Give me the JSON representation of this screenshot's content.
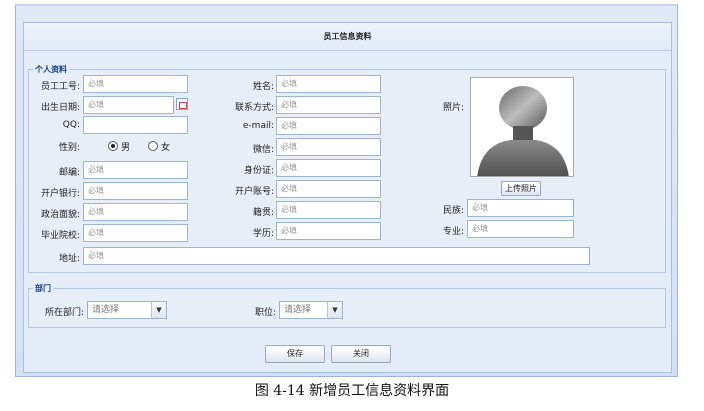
{
  "panel_title": "员工信息资料",
  "sections": {
    "personal": "个人资料",
    "department": "部门"
  },
  "fields": {
    "emp_no": {
      "label": "员工工号:",
      "placeholder": "必填"
    },
    "birth": {
      "label": "出生日期:",
      "placeholder": "必填"
    },
    "qq": {
      "label": "QQ:"
    },
    "gender": {
      "label": "性别:",
      "male": "男",
      "female": "女",
      "selected": "男"
    },
    "postcode": {
      "label": "邮编:",
      "placeholder": "必填"
    },
    "bank": {
      "label": "开户银行:",
      "placeholder": "必填"
    },
    "politics": {
      "label": "政治面貌:",
      "placeholder": "必填"
    },
    "school": {
      "label": "毕业院校:",
      "placeholder": "必填"
    },
    "address": {
      "label": "地址:",
      "placeholder": "必填"
    },
    "name": {
      "label": "姓名:",
      "placeholder": "必填"
    },
    "contact": {
      "label": "联系方式:",
      "placeholder": "必填"
    },
    "email": {
      "label": "e-mail:",
      "placeholder": "必填"
    },
    "wechat": {
      "label": "微信:",
      "placeholder": "必填"
    },
    "id_card": {
      "label": "身份证:",
      "placeholder": "必填"
    },
    "account": {
      "label": "开户账号:",
      "placeholder": "必填"
    },
    "native": {
      "label": "籍贯:",
      "placeholder": "必填"
    },
    "education": {
      "label": "学历:",
      "placeholder": "必填"
    },
    "photo": {
      "label": "照片:",
      "upload_label": "上传照片"
    },
    "ethnicity": {
      "label": "民族:",
      "placeholder": "必填"
    },
    "major": {
      "label": "专业:",
      "placeholder": "必填"
    }
  },
  "dept": {
    "label": "所在部门:",
    "value": "请选择"
  },
  "position": {
    "label": "职位:",
    "value": "请选择"
  },
  "buttons": {
    "save": "保存",
    "close": "关闭"
  },
  "caption": "图 4-14 新增员工信息资料界面"
}
